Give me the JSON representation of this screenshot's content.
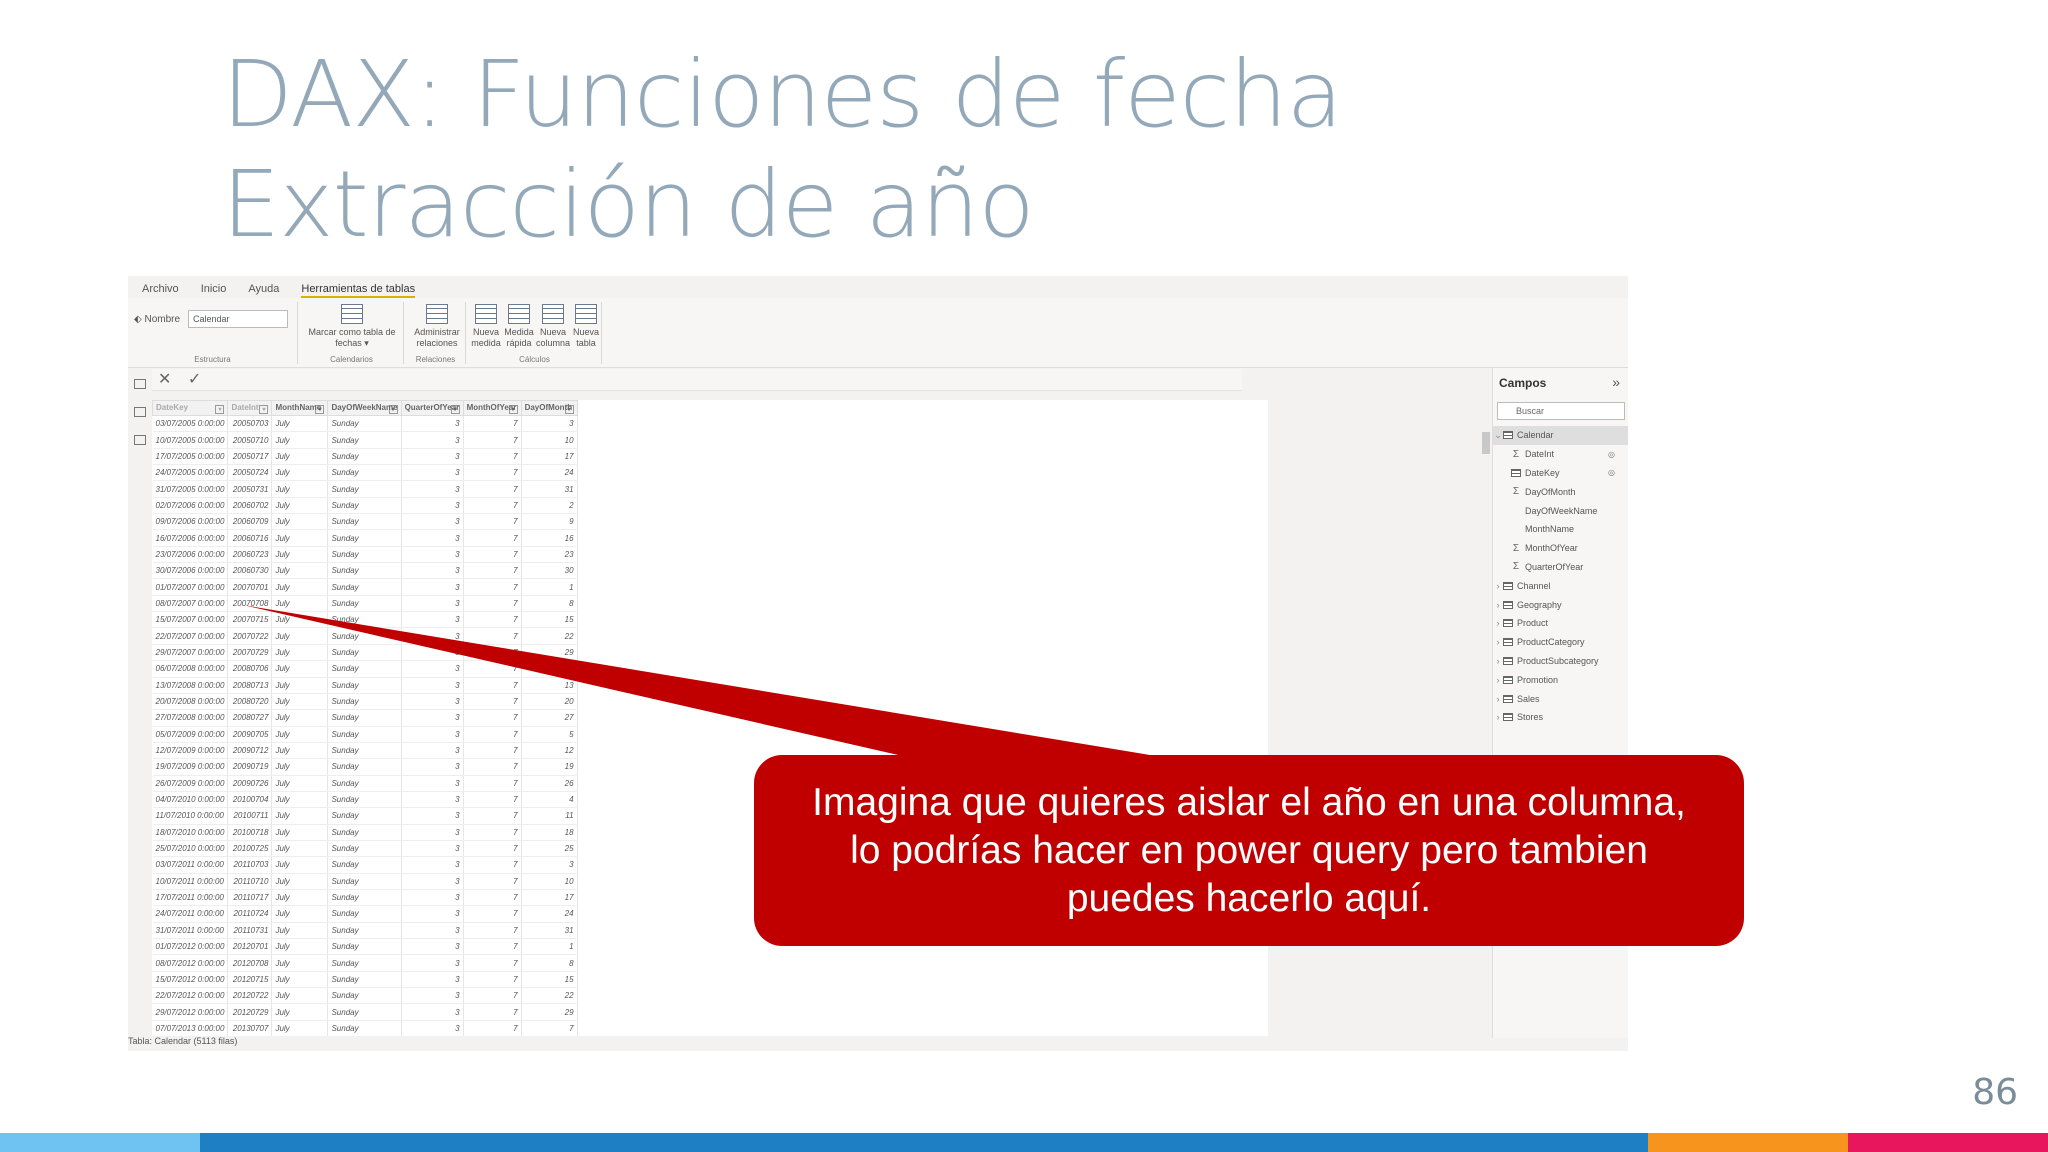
{
  "slide": {
    "title_line1": "DAX: Funciones de fecha",
    "title_line2": "Extracción de año",
    "page_number": "86",
    "bottom_bar_colors": [
      "#6fc3f2",
      "#1f7fc4",
      "#f7941d",
      "#e8175d"
    ]
  },
  "app": {
    "menu": [
      "Archivo",
      "Inicio",
      "Ayuda",
      "Herramientas de tablas"
    ],
    "ribbon": {
      "nombre_label": "Nombre",
      "nombre_value": "Calendar",
      "estructura_label": "Estructura",
      "marcar_label": "Marcar como tabla de fechas ▾",
      "calendarios_label": "Calendarios",
      "administrar_label": "Administrar relaciones",
      "relaciones_label": "Relaciones",
      "nueva_medida_label": "Nueva medida",
      "medida_rapida_label": "Medida rápida",
      "nueva_columna_label": "Nueva columna",
      "nueva_tabla_label": "Nueva tabla",
      "calculos_label": "Cálculos"
    },
    "formula_bar": {
      "cancel": "✕",
      "commit": "✓"
    },
    "table": {
      "columns": [
        "DateKey",
        "DateInt",
        "MonthName",
        "DayOfWeekName",
        "QuarterOfYear",
        "MonthOfYear",
        "DayOfMonth"
      ],
      "rows": [
        [
          "03/07/2005 0:00:00",
          "20050703",
          "July",
          "Sunday",
          "3",
          "7",
          "3"
        ],
        [
          "10/07/2005 0:00:00",
          "20050710",
          "July",
          "Sunday",
          "3",
          "7",
          "10"
        ],
        [
          "17/07/2005 0:00:00",
          "20050717",
          "July",
          "Sunday",
          "3",
          "7",
          "17"
        ],
        [
          "24/07/2005 0:00:00",
          "20050724",
          "July",
          "Sunday",
          "3",
          "7",
          "24"
        ],
        [
          "31/07/2005 0:00:00",
          "20050731",
          "July",
          "Sunday",
          "3",
          "7",
          "31"
        ],
        [
          "02/07/2006 0:00:00",
          "20060702",
          "July",
          "Sunday",
          "3",
          "7",
          "2"
        ],
        [
          "09/07/2006 0:00:00",
          "20060709",
          "July",
          "Sunday",
          "3",
          "7",
          "9"
        ],
        [
          "16/07/2006 0:00:00",
          "20060716",
          "July",
          "Sunday",
          "3",
          "7",
          "16"
        ],
        [
          "23/07/2006 0:00:00",
          "20060723",
          "July",
          "Sunday",
          "3",
          "7",
          "23"
        ],
        [
          "30/07/2006 0:00:00",
          "20060730",
          "July",
          "Sunday",
          "3",
          "7",
          "30"
        ],
        [
          "01/07/2007 0:00:00",
          "20070701",
          "July",
          "Sunday",
          "3",
          "7",
          "1"
        ],
        [
          "08/07/2007 0:00:00",
          "20070708",
          "July",
          "Sunday",
          "3",
          "7",
          "8"
        ],
        [
          "15/07/2007 0:00:00",
          "20070715",
          "July",
          "Sunday",
          "3",
          "7",
          "15"
        ],
        [
          "22/07/2007 0:00:00",
          "20070722",
          "July",
          "Sunday",
          "3",
          "7",
          "22"
        ],
        [
          "29/07/2007 0:00:00",
          "20070729",
          "July",
          "Sunday",
          "3",
          "7",
          "29"
        ],
        [
          "06/07/2008 0:00:00",
          "20080706",
          "July",
          "Sunday",
          "3",
          "7",
          "6"
        ],
        [
          "13/07/2008 0:00:00",
          "20080713",
          "July",
          "Sunday",
          "3",
          "7",
          "13"
        ],
        [
          "20/07/2008 0:00:00",
          "20080720",
          "July",
          "Sunday",
          "3",
          "7",
          "20"
        ],
        [
          "27/07/2008 0:00:00",
          "20080727",
          "July",
          "Sunday",
          "3",
          "7",
          "27"
        ],
        [
          "05/07/2009 0:00:00",
          "20090705",
          "July",
          "Sunday",
          "3",
          "7",
          "5"
        ],
        [
          "12/07/2009 0:00:00",
          "20090712",
          "July",
          "Sunday",
          "3",
          "7",
          "12"
        ],
        [
          "19/07/2009 0:00:00",
          "20090719",
          "July",
          "Sunday",
          "3",
          "7",
          "19"
        ],
        [
          "26/07/2009 0:00:00",
          "20090726",
          "July",
          "Sunday",
          "3",
          "7",
          "26"
        ],
        [
          "04/07/2010 0:00:00",
          "20100704",
          "July",
          "Sunday",
          "3",
          "7",
          "4"
        ],
        [
          "11/07/2010 0:00:00",
          "20100711",
          "July",
          "Sunday",
          "3",
          "7",
          "11"
        ],
        [
          "18/07/2010 0:00:00",
          "20100718",
          "July",
          "Sunday",
          "3",
          "7",
          "18"
        ],
        [
          "25/07/2010 0:00:00",
          "20100725",
          "July",
          "Sunday",
          "3",
          "7",
          "25"
        ],
        [
          "03/07/2011 0:00:00",
          "20110703",
          "July",
          "Sunday",
          "3",
          "7",
          "3"
        ],
        [
          "10/07/2011 0:00:00",
          "20110710",
          "July",
          "Sunday",
          "3",
          "7",
          "10"
        ],
        [
          "17/07/2011 0:00:00",
          "20110717",
          "July",
          "Sunday",
          "3",
          "7",
          "17"
        ],
        [
          "24/07/2011 0:00:00",
          "20110724",
          "July",
          "Sunday",
          "3",
          "7",
          "24"
        ],
        [
          "31/07/2011 0:00:00",
          "20110731",
          "July",
          "Sunday",
          "3",
          "7",
          "31"
        ],
        [
          "01/07/2012 0:00:00",
          "20120701",
          "July",
          "Sunday",
          "3",
          "7",
          "1"
        ],
        [
          "08/07/2012 0:00:00",
          "20120708",
          "July",
          "Sunday",
          "3",
          "7",
          "8"
        ],
        [
          "15/07/2012 0:00:00",
          "20120715",
          "July",
          "Sunday",
          "3",
          "7",
          "15"
        ],
        [
          "22/07/2012 0:00:00",
          "20120722",
          "July",
          "Sunday",
          "3",
          "7",
          "22"
        ],
        [
          "29/07/2012 0:00:00",
          "20120729",
          "July",
          "Sunday",
          "3",
          "7",
          "29"
        ],
        [
          "07/07/2013 0:00:00",
          "20130707",
          "July",
          "Sunday",
          "3",
          "7",
          "7"
        ]
      ]
    },
    "status": "Tabla: Calendar (5113 filas)",
    "fields_pane": {
      "title": "Campos",
      "collapse_icon": "»",
      "search_placeholder": "Buscar",
      "items": [
        {
          "label": "Calendar",
          "kind": "table",
          "expanded": true,
          "level": 0,
          "selected": true
        },
        {
          "label": "DateInt",
          "kind": "sigma",
          "level": 1,
          "hidden": true
        },
        {
          "label": "DateKey",
          "kind": "table",
          "level": 1,
          "hidden": true
        },
        {
          "label": "DayOfMonth",
          "kind": "sigma",
          "level": 1
        },
        {
          "label": "DayOfWeekName",
          "kind": "text",
          "level": 1
        },
        {
          "label": "MonthName",
          "kind": "text",
          "level": 1
        },
        {
          "label": "MonthOfYear",
          "kind": "sigma",
          "level": 1
        },
        {
          "label": "QuarterOfYear",
          "kind": "sigma",
          "level": 1
        },
        {
          "label": "Channel",
          "kind": "table",
          "level": 0
        },
        {
          "label": "Geography",
          "kind": "table",
          "level": 0
        },
        {
          "label": "Product",
          "kind": "table",
          "level": 0
        },
        {
          "label": "ProductCategory",
          "kind": "table",
          "level": 0
        },
        {
          "label": "ProductSubcategory",
          "kind": "table",
          "level": 0
        },
        {
          "label": "Promotion",
          "kind": "table",
          "level": 0
        },
        {
          "label": "Sales",
          "kind": "table",
          "level": 0
        },
        {
          "label": "Stores",
          "kind": "table",
          "level": 0
        }
      ]
    }
  },
  "callout": {
    "text_line1": "Imagina que quieres aislar el año en una columna,",
    "text_line2": "lo podrías hacer en power query pero tambien",
    "text_line3": "puedes hacerlo aquí.",
    "color": "#c00000"
  }
}
